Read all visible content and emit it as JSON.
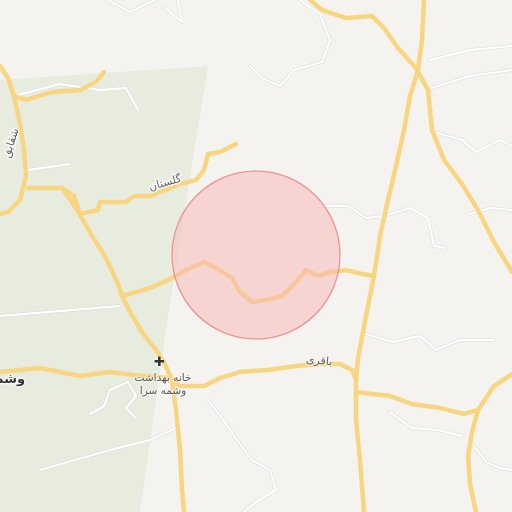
{
  "map": {
    "colors": {
      "background": "#f5f3ef",
      "park": "#e8ecdf",
      "major_road": "#f8d681",
      "minor_road": "#ffffff",
      "highlight_fill": "#f7b9b9",
      "highlight_stroke": "#ee8a8a"
    },
    "labels": {
      "golestan": "گلستان",
      "baqri": "باقری",
      "shaghayegh": "شقایق",
      "health_house_line1": "خانه بهداشت",
      "health_house_line2": "وشمه سرا",
      "place_partial": "وشم"
    },
    "icons": {
      "health_house": "medical-cross-icon"
    }
  }
}
